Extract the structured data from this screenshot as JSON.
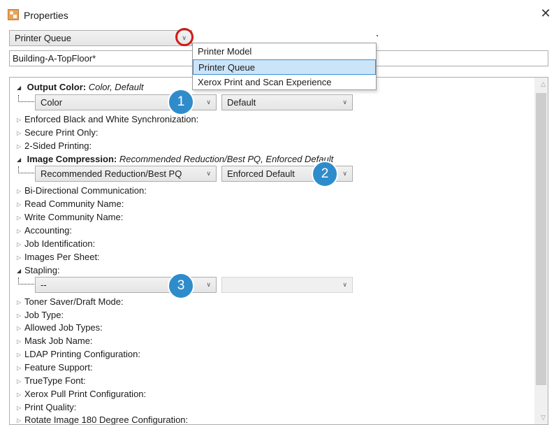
{
  "window": {
    "title": "Properties",
    "close_glyph": "✕",
    "app_icon": "properties-app-icon"
  },
  "mode_select": {
    "value": "Printer Queue"
  },
  "name_field": {
    "value": "Building-A-TopFloor*"
  },
  "dropdown": {
    "options": [
      "Printer Model",
      "Printer Queue",
      "Xerox Print and Scan Experience"
    ],
    "selected": "Printer Queue"
  },
  "properties": {
    "output_color": {
      "label": "Output Color:",
      "summary": "Color, Default",
      "value_select": "Color",
      "mode_select": "Default",
      "badge": "1"
    },
    "enforced_bw": "Enforced Black and White Synchronization:",
    "secure_print": "Secure Print Only:",
    "two_sided": "2-Sided Printing:",
    "image_compression": {
      "label": "Image Compression:",
      "summary": "Recommended Reduction/Best PQ, Enforced Default",
      "value_select": "Recommended Reduction/Best PQ",
      "mode_select": "Enforced Default",
      "badge": "2"
    },
    "items_mid": [
      "Bi-Directional Communication:",
      "Read Community Name:",
      "Write Community Name:",
      "Accounting:",
      "Job Identification:",
      "Images Per Sheet:"
    ],
    "stapling": {
      "label": "Stapling:",
      "value_select": "--",
      "mode_select": "",
      "badge": "3"
    },
    "items_end": [
      "Toner Saver/Draft Mode:",
      "Job Type:",
      "Allowed Job Types:",
      "Mask Job Name:",
      "LDAP Printing Configuration:",
      "Feature Support:",
      "TrueType Font:",
      "Xerox Pull Print Configuration:",
      "Print Quality:",
      "Rotate Image 180 Degree Configuration:"
    ]
  },
  "colors": {
    "badge": "#2f8ccb",
    "highlight": "#cce4f7",
    "highlight_border": "#3a8fd6",
    "ring": "#d11a1a"
  }
}
